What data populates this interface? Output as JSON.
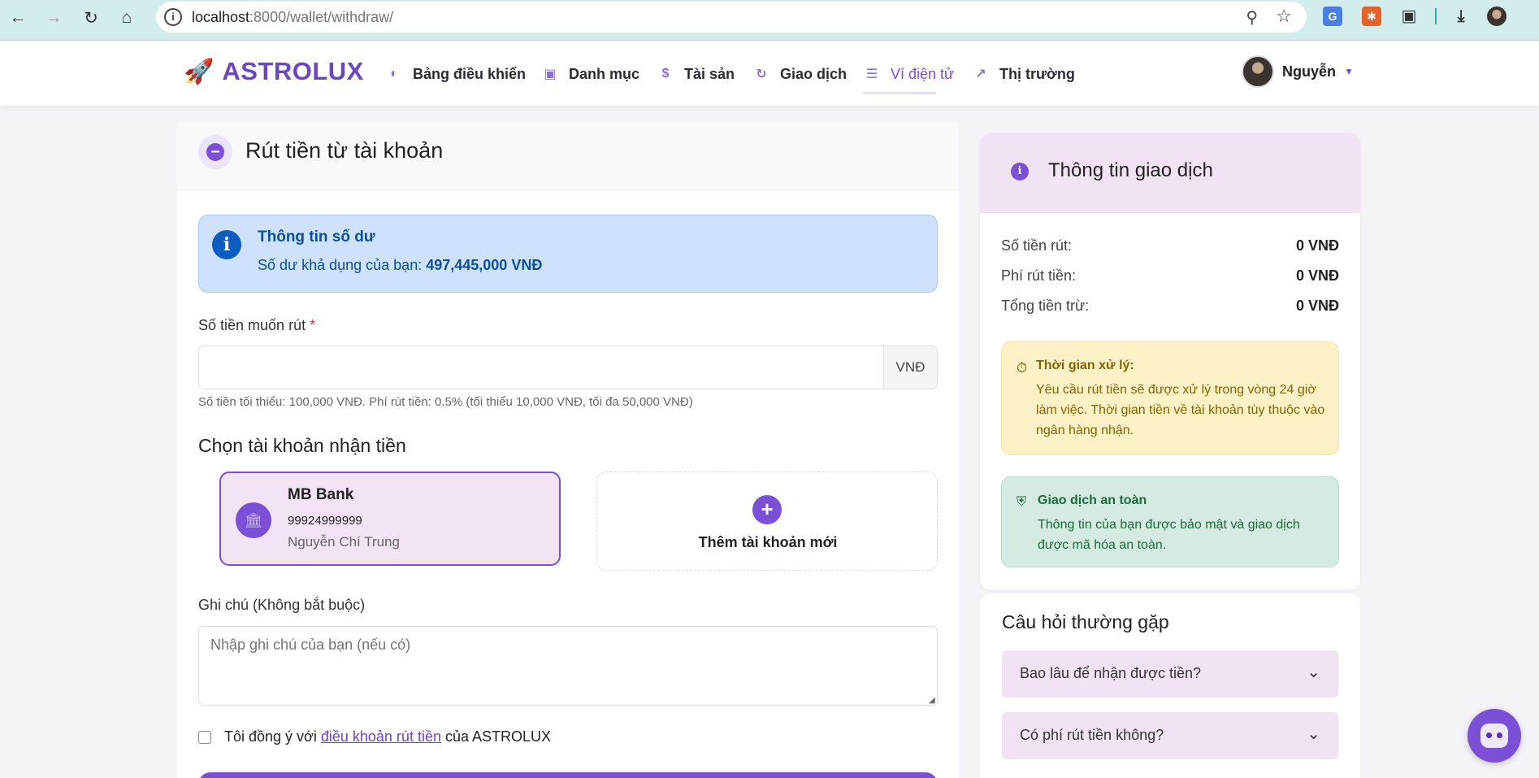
{
  "browser": {
    "url_host": "localhost",
    "url_rest": ":8000/wallet/withdraw/"
  },
  "navbar": {
    "brand": "ASTROLUX",
    "items": [
      {
        "label": "Bảng điều khiển",
        "icon": "dashboard-icon"
      },
      {
        "label": "Danh mục",
        "icon": "portfolio-icon"
      },
      {
        "label": "Tài sản",
        "icon": "assets-icon"
      },
      {
        "label": "Giao dịch",
        "icon": "transactions-icon"
      },
      {
        "label": "Ví điện tử",
        "icon": "wallet-icon",
        "active": true
      },
      {
        "label": "Thị trường",
        "icon": "market-icon"
      }
    ],
    "user_name": "Nguyễn"
  },
  "page": {
    "title": "Rút tiền từ tài khoản"
  },
  "balance": {
    "title": "Thông tin số dư",
    "label": "Số dư khả dụng của bạn:",
    "value": "497,445,000 VNĐ"
  },
  "form": {
    "amount_label": "Số tiền muốn rút",
    "required_mark": "*",
    "amount_value": "",
    "amount_unit": "VNĐ",
    "hint": "Số tiền tối thiểu: 100,000 VNĐ. Phí rút tiền: 0.5% (tối thiểu 10,000 VNĐ, tối đa 50,000 VNĐ)",
    "account_section_title": "Chọn tài khoản nhận tiền",
    "selected_account": {
      "bank": "MB Bank",
      "number": "99924999999",
      "owner": "Nguyễn Chí Trung"
    },
    "add_account_label": "Thêm tài khoản mới",
    "note_label": "Ghi chú (Không bắt buộc)",
    "note_placeholder": "Nhập ghi chú của bạn (nếu có)",
    "terms_prefix": "Tôi đồng ý với",
    "terms_link": "điều khoản rút tiền",
    "terms_suffix": "của ASTROLUX"
  },
  "transaction_info": {
    "title": "Thông tin giao dịch",
    "rows": [
      {
        "label": "Số tiền rút:",
        "value": "0 VNĐ"
      },
      {
        "label": "Phí rút tiền:",
        "value": "0 VNĐ"
      },
      {
        "label": "Tổng tiền trừ:",
        "value": "0 VNĐ"
      }
    ],
    "processing": {
      "title": "Thời gian xử lý:",
      "text": "Yêu cầu rút tiền sẽ được xử lý trong vòng 24 giờ làm việc. Thời gian tiền về tài khoản tùy thuộc vào ngân hàng nhận."
    },
    "safe": {
      "title": "Giao dịch an toàn",
      "text": "Thông tin của bạn được bảo mật và giao dịch được mã hóa an toàn."
    }
  },
  "faq": {
    "title": "Câu hỏi thường gặp",
    "items": [
      {
        "question": "Bao lâu để nhận được tiền?"
      },
      {
        "question": "Có phí rút tiền không?"
      }
    ]
  },
  "colors": {
    "accent": "#7b4fd6",
    "info_bg": "#cfe2fb",
    "warn_bg": "#fdf2c6",
    "safe_bg": "#d3ebe0"
  }
}
